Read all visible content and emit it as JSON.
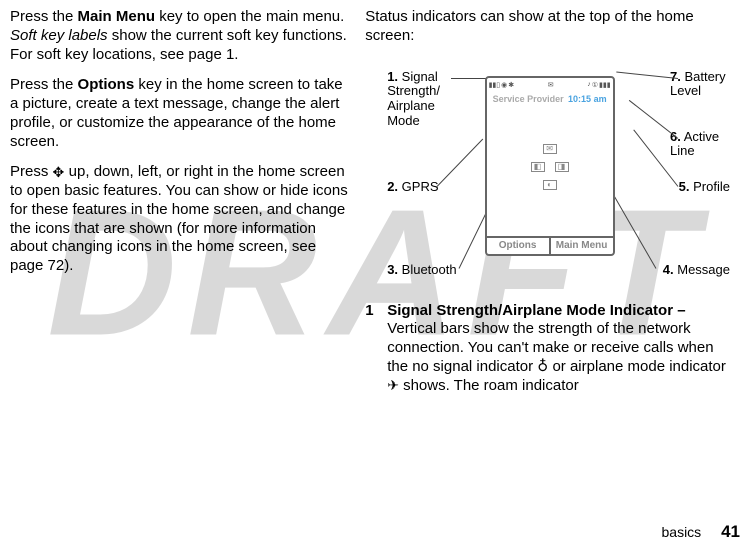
{
  "watermark": "DRAFT",
  "left": {
    "p1_a": "Press the ",
    "p1_mainmenu": "Main Menu",
    "p1_b": " key to open the main menu. ",
    "p1_softkey_italic": "Soft key labels",
    "p1_c": " show the current soft key functions. For soft key locations, see page 1.",
    "p2_a": "Press the ",
    "p2_options": "Options",
    "p2_b": " key in the home screen to take a picture, create a text message, change the alert profile, or customize the appearance of the home screen.",
    "p3_a": "Press ",
    "p3_b": " up, down, left, or right in the home screen to open basic features. You can show or hide icons for these features in the home screen, and change the icons that are shown (for more information about changing icons in the home screen, see page 72)."
  },
  "right": {
    "intro": "Status indicators can show at the top of the home screen:",
    "phone": {
      "service_provider": "Service Provider",
      "time": "10:15 am",
      "soft_left": "Options",
      "soft_right": "Main Menu"
    },
    "callouts": {
      "c1_num": "1.",
      "c1_label": "Signal Strength/ Airplane Mode",
      "c2_num": "2.",
      "c2_label": "GPRS",
      "c3_num": "3.",
      "c3_label": "Bluetooth",
      "c4_num": "4.",
      "c4_label": "Message",
      "c5_num": "5.",
      "c5_label": "Profile",
      "c6_num": "6.",
      "c6_label": "Active Line",
      "c7_num": "7.",
      "c7_label": "Battery Level"
    },
    "def1_num": "1",
    "def1_title": "Signal Strength/Airplane Mode Indicator – ",
    "def1_body_a": "Vertical bars show the strength of the network connection. You can't make or receive calls when the no signal indicator ",
    "def1_nosig": "♁",
    "def1_body_b": " or airplane mode indicator ",
    "def1_body_c": " shows. The roam indicator"
  },
  "footer": {
    "section": "basics",
    "page": "41"
  }
}
